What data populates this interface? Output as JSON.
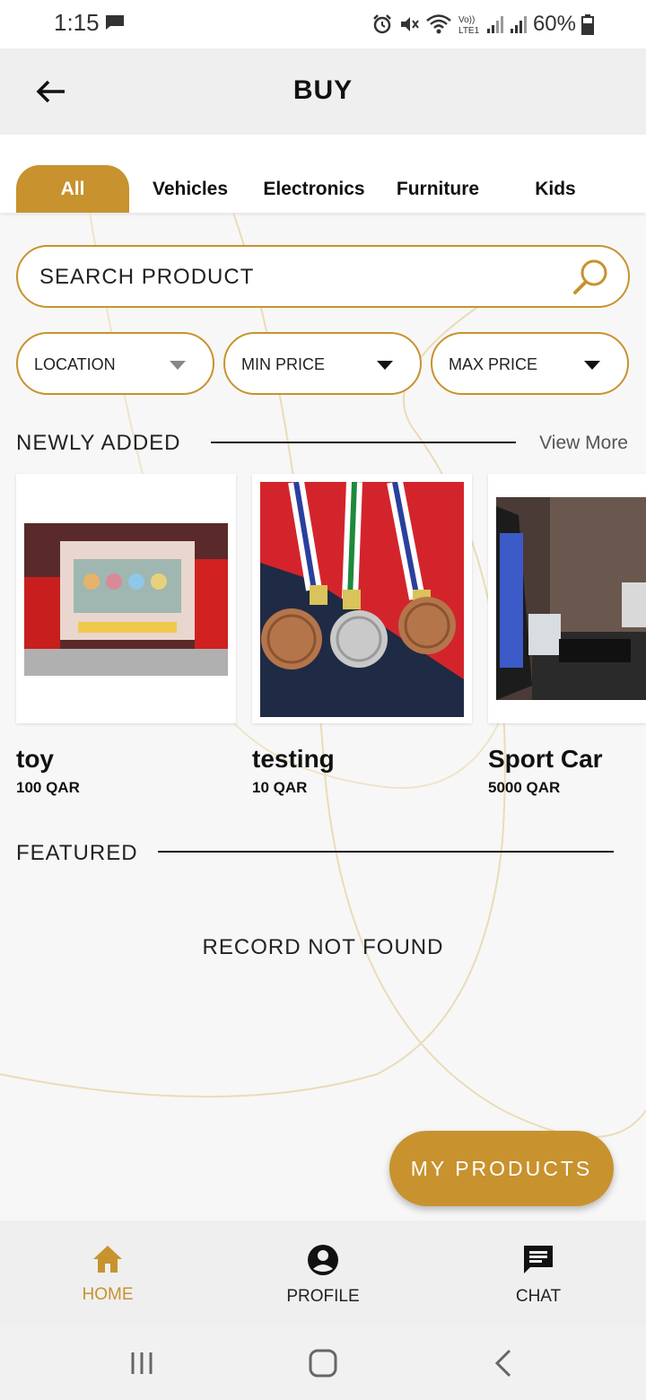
{
  "status_bar": {
    "time": "1:15",
    "battery": "60%",
    "icons": [
      "alarm-icon",
      "mute-icon",
      "wifi-icon",
      "volte-icon",
      "signal-icon",
      "signal-icon",
      "battery-icon"
    ],
    "volte_label": "Vo))",
    "lte_label": "LTE1"
  },
  "header": {
    "title": "BUY",
    "back_icon": "back-arrow-icon"
  },
  "tabs": [
    {
      "label": "All",
      "active": true
    },
    {
      "label": "Vehicles",
      "active": false
    },
    {
      "label": "Electronics",
      "active": false
    },
    {
      "label": "Furniture",
      "active": false
    },
    {
      "label": "Kids",
      "active": false
    }
  ],
  "search": {
    "placeholder": "SEARCH PRODUCT",
    "icon": "search-icon"
  },
  "filters": [
    {
      "label": "LOCATION"
    },
    {
      "label": "MIN PRICE"
    },
    {
      "label": "MAX PRICE"
    }
  ],
  "newly_added": {
    "title": "NEWLY ADDED",
    "view_more": "View More",
    "products": [
      {
        "name": "toy",
        "price": "100 QAR"
      },
      {
        "name": "testing",
        "price": "10 QAR"
      },
      {
        "name": "Sport Car",
        "price": "5000 QAR"
      }
    ]
  },
  "featured": {
    "title": "FEATURED",
    "empty_message": "RECORD NOT FOUND"
  },
  "fab": {
    "label": "MY PRODUCTS"
  },
  "bottom_nav": [
    {
      "label": "HOME",
      "icon": "home-icon",
      "active": true
    },
    {
      "label": "PROFILE",
      "icon": "profile-icon",
      "active": false
    },
    {
      "label": "CHAT",
      "icon": "chat-icon",
      "active": false
    }
  ],
  "colors": {
    "accent": "#c8922e",
    "header_bg": "#efefef",
    "page_bg": "#f7f7f7"
  }
}
